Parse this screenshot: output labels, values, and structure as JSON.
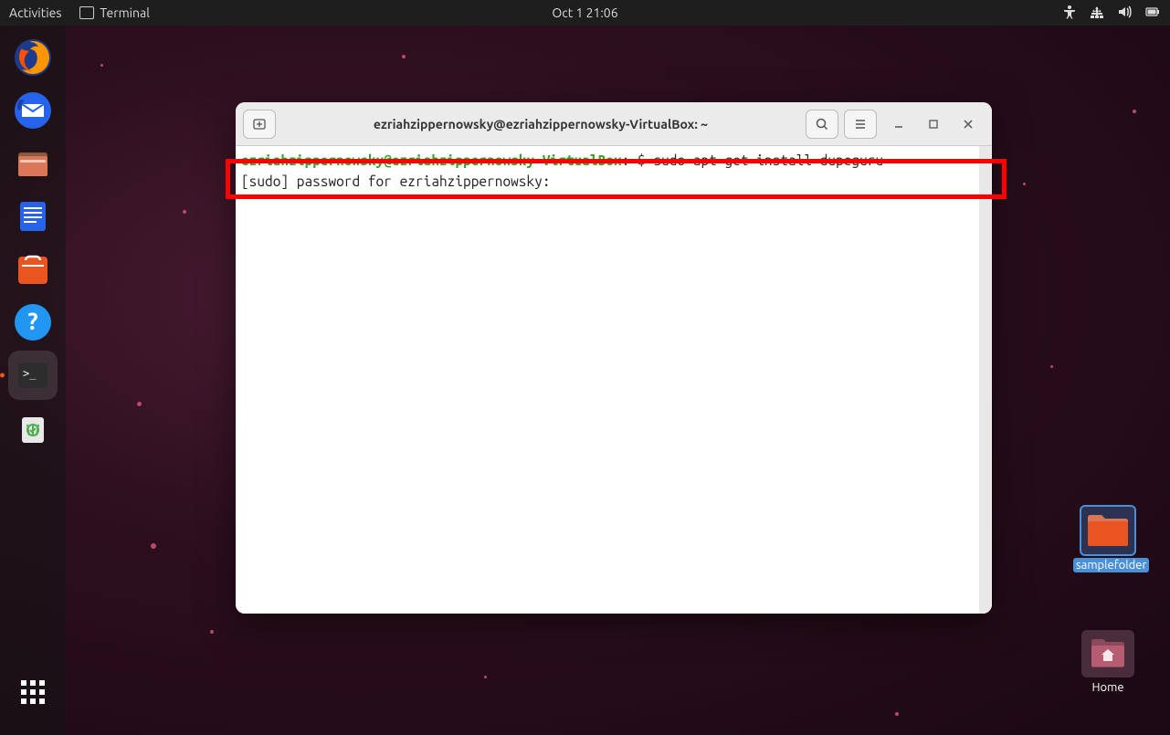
{
  "topbar": {
    "activities": "Activities",
    "app_name": "Terminal",
    "datetime": "Oct 1  21:06"
  },
  "desktop": {
    "samplefolder_label": "samplefolder",
    "home_label": "Home"
  },
  "terminal": {
    "title": "ezriahzippernowsky@ezriahzippernowsky-VirtualBox: ~",
    "prompt_user_host": "ezriahzippernowsky@ezriahzippernowsky-VirtualBox",
    "prompt_sep": ":",
    "prompt_path": "~",
    "prompt_dollar": "$ ",
    "command": "sudo apt-get install dupeguru",
    "line2": "[sudo] password for ezriahzippernowsky: "
  }
}
